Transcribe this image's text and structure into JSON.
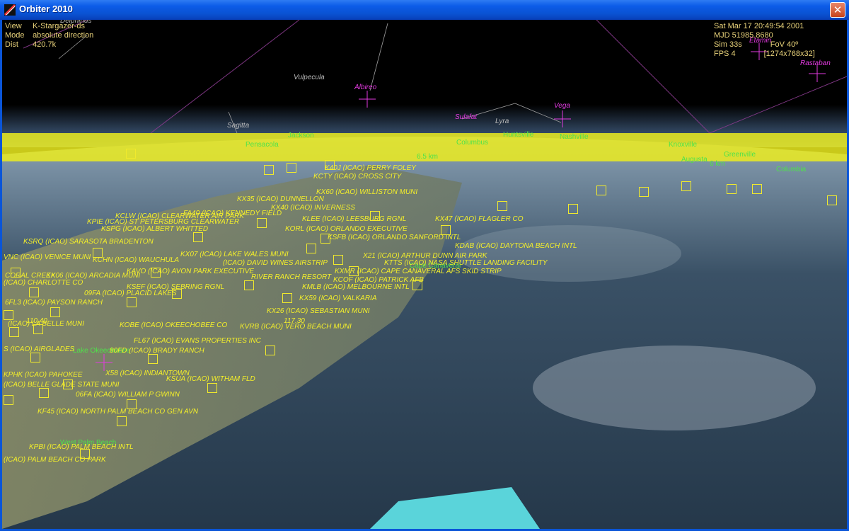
{
  "window": {
    "title": "Orbiter 2010",
    "close_glyph": "✕"
  },
  "hud_left": {
    "rows": [
      {
        "key": "View",
        "value": "K-Stargazer-ds"
      },
      {
        "key": "Mode",
        "value": "absolute direction"
      },
      {
        "key": "Dist",
        "value": "420.7k"
      }
    ]
  },
  "hud_right": {
    "date": "Sat Mar 17 20:49:54 2001",
    "mjd": "MJD 51985.8680",
    "sim": "Sim  33s",
    "fov": "FoV  40º",
    "fps": "FPS  4",
    "res": "[1274x768x32]"
  },
  "constellations": [
    "Delphinus",
    "Vulpecula",
    "Sagitta",
    "Lyra"
  ],
  "stars": [
    "Albireo",
    "Sulafat",
    "Vega",
    "Etamin",
    "Rastaban"
  ],
  "green_labels": [
    "Jackson",
    "Pensacola",
    "Columbus",
    "Huntsville",
    "Nashville",
    "Knoxville",
    "Greenville",
    "Augusta",
    "Columbia",
    "Lake Okeechobee",
    "West Palm Beach",
    "Cape Canaveral"
  ],
  "distance_labels": [
    "6.5 km",
    "6 km"
  ],
  "airports": [
    "KSRQ (ICAO) SARASOTA BRADENTON",
    "VNC (ICAO) VENICE MUNI",
    "CORAL CREEK",
    "KX06 (ICAO) ARCADIA MUNI",
    "(ICAO) CHARLOTTE CO",
    "09FA (ICAO) PLACID LAKES",
    "6FL3 (ICAO) PAYSON RANCH",
    "(ICAO) LA BELLE MUNI",
    "S (ICAO) AIRGLADES",
    "KPHK (ICAO) PAHOKEE",
    "(ICAO) BELLE GLADE STATE MUNI",
    "KSUA (ICAO) WITHAM FLD",
    "06FA (ICAO) WILLIAM P GWINN",
    "KF45 (ICAO) NORTH PALM BEACH CO GEN AVN",
    "KPBI (ICAO) PALM BEACH INTL",
    "(ICAO) PALM BEACH CO PARK",
    "KOBE (ICAO) OKEECHOBEE CO",
    "FL67 (ICAO) EVANS PROPERTIES INC",
    "80FD (ICAO) BRADY RANCH",
    "X58 (ICAO) INDIANTOWN",
    "KVRB (ICAO) VERO BEACH MUNI",
    "KX26 (ICAO) SEBASTIAN MUNI",
    "KX59 (ICAO) VALKARIA",
    "KMLB (ICAO) MELBOURNE INTL",
    "KSEF (ICAO) SEBRING RGNL",
    "KAVO (ICAO) AVON PARK EXECUTIVE",
    "KCHN (ICAO) WAUCHULA",
    "KX07 (ICAO) LAKE WALES MUNI",
    "(ICAO) DAVID WINES AIRSTRIP",
    "RIVER RANCH RESORT",
    "KCOF (ICAO) PATRICK AFB",
    "KXMR (ICAO) CAPE CANAVERAL AFS SKID STRIP",
    "X21 (ICAO) ARTHUR DUNN AIR PARK",
    "KTTS (ICAO) NASA SHUTTLE LANDING FACILITY",
    "KPIE (ICAO) ST PETERSBURG CLEARWATER",
    "KSPG (ICAO) ALBERT WHITTED",
    "KCLW (ICAO) CLEARWATER AIR PARK",
    "KX35 (ICAO) DUNNELLON",
    "KX40 (ICAO) INVERNESS",
    "KLEE (ICAO) LEESBURG RGNL",
    "KORL (ICAO) ORLANDO EXECUTIVE",
    "KSFB (ICAO) ORLANDO SANFORD INTL",
    "KX47 (ICAO) FLAGLER CO",
    "KDAB (ICAO) DAYTONA BEACH INTL",
    "KCTY (ICAO) CROSS CITY",
    "KX60 (ICAO) WILLISTON MUNI",
    "K40J (ICAO) PERRY FOLEY",
    "FA40 (ICAO) KENNEDY FIELD"
  ],
  "freq_labels": [
    "110.40",
    "117.30"
  ]
}
